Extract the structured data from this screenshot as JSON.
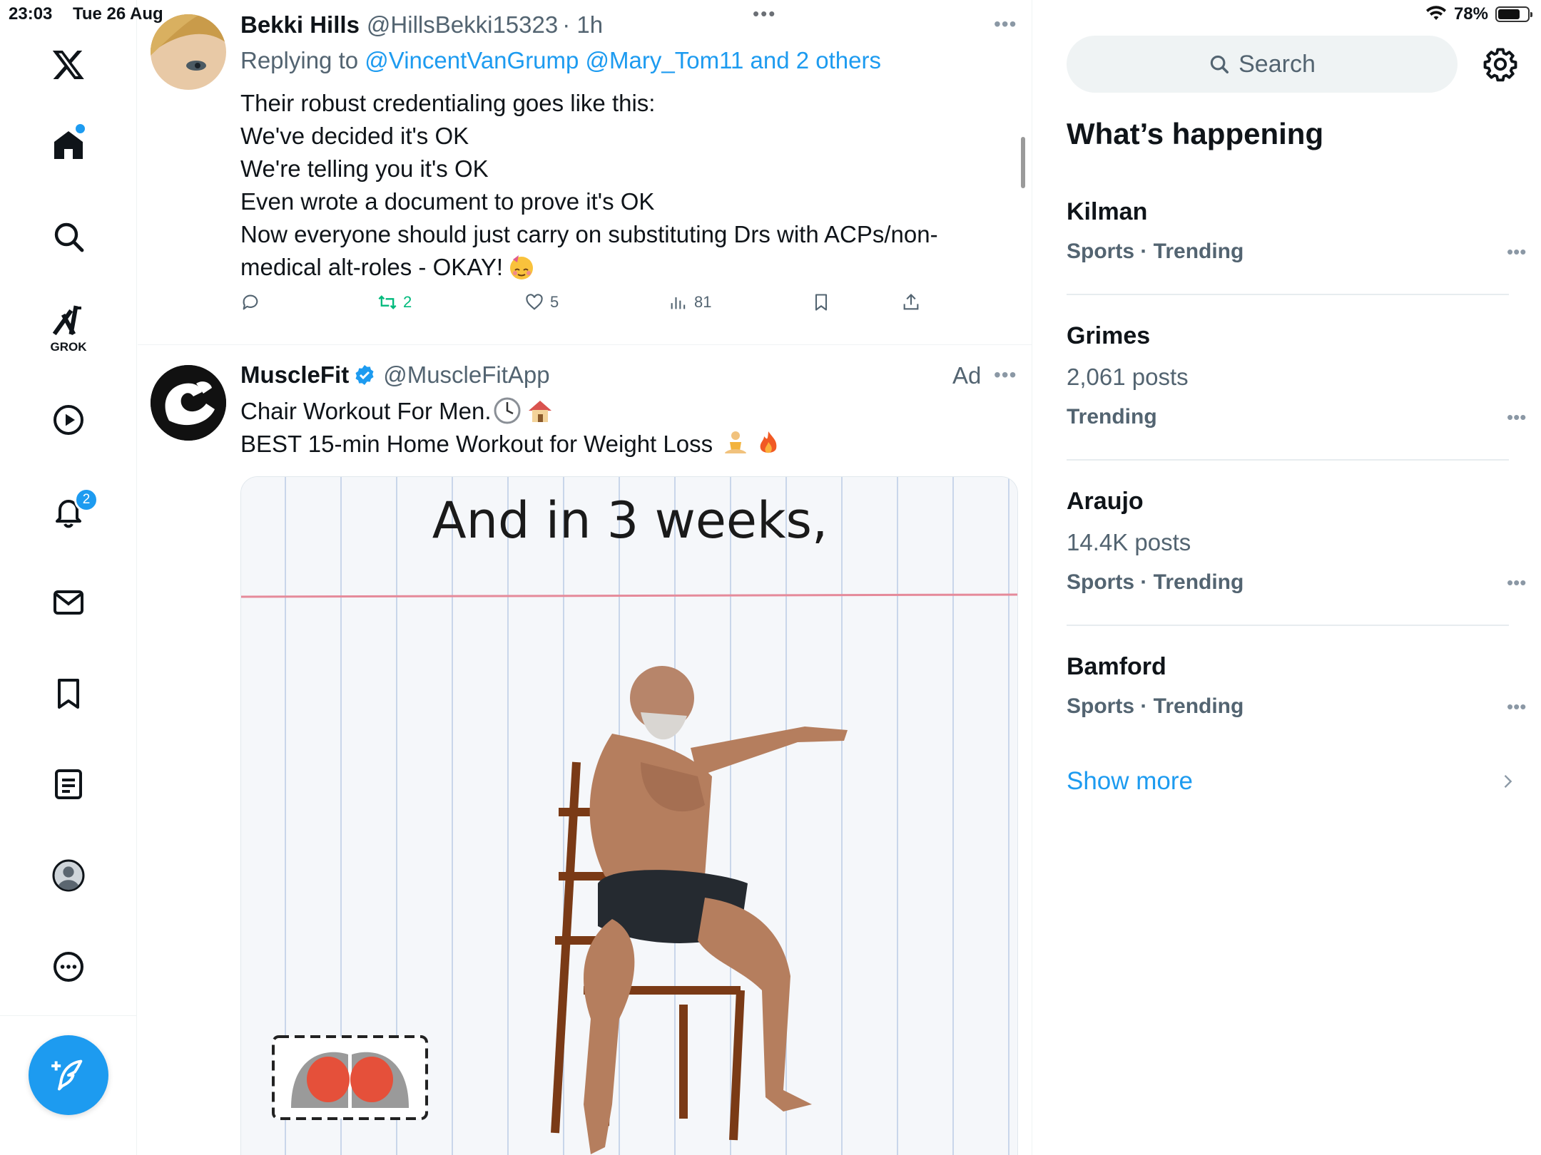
{
  "status_bar": {
    "time": "23:03",
    "date": "Tue 26 Aug",
    "center_indicator": "•••",
    "battery_percent": "78%",
    "battery_level": 0.78
  },
  "nav": {
    "items": [
      {
        "name": "x-logo-icon"
      },
      {
        "name": "home-icon",
        "has_dot": true
      },
      {
        "name": "search-icon"
      },
      {
        "name": "grok-icon",
        "label": "GROK"
      },
      {
        "name": "video-icon"
      },
      {
        "name": "notifications-icon",
        "badge": "2"
      },
      {
        "name": "messages-icon"
      },
      {
        "name": "bookmarks-icon"
      },
      {
        "name": "lists-icon"
      },
      {
        "name": "profile-icon"
      },
      {
        "name": "more-icon"
      }
    ],
    "compose_icon": "compose-quill-icon"
  },
  "feed": {
    "tweet1": {
      "name": "Bekki Hills",
      "handle": "@HillsBekki15323",
      "time": "· 1h",
      "replying_prefix": "Replying to",
      "replying_to": "@VincentVanGrump @Mary_Tom11 and 2 others",
      "body": [
        "Their robust credentialing goes like this:",
        "We've decided it's OK",
        "We're telling you it's OK",
        "Even wrote a document to prove it's OK",
        "Now everyone should just carry on substituting Drs with ACPs/non-",
        "medical alt-roles - OKAY!"
      ],
      "emoji": "party-face-emoji",
      "actions": {
        "retweets": "2",
        "likes": "5",
        "views": "81"
      }
    },
    "tweet2": {
      "name": "MuscleFit",
      "handle": "@MuscleFitApp",
      "ad_label": "Ad",
      "line1": "Chair Workout For Men.",
      "line1_emojis": [
        "clock-emoji",
        "house-emoji"
      ],
      "line2": "BEST 15-min Home Workout for Weight Loss",
      "line2_emojis": [
        "meditation-emoji",
        "fire-emoji"
      ],
      "media_caption": "And in 3 weeks,"
    }
  },
  "sidebar": {
    "search_placeholder": "Search",
    "section_title": "What’s happening",
    "trends": [
      {
        "name": "Kilman",
        "posts": "",
        "meta": "Sports · Trending"
      },
      {
        "name": "Grimes",
        "posts": "2,061 posts",
        "meta": "Trending"
      },
      {
        "name": "Araujo",
        "posts": "14.4K posts",
        "meta": "Sports · Trending"
      },
      {
        "name": "Bamford",
        "posts": "",
        "meta": "Sports · Trending"
      }
    ],
    "show_more": "Show more"
  },
  "colors": {
    "accent": "#1d9bf0",
    "text_primary": "#0f1419",
    "text_secondary": "#536471",
    "retweet_green": "#00ba7c"
  }
}
